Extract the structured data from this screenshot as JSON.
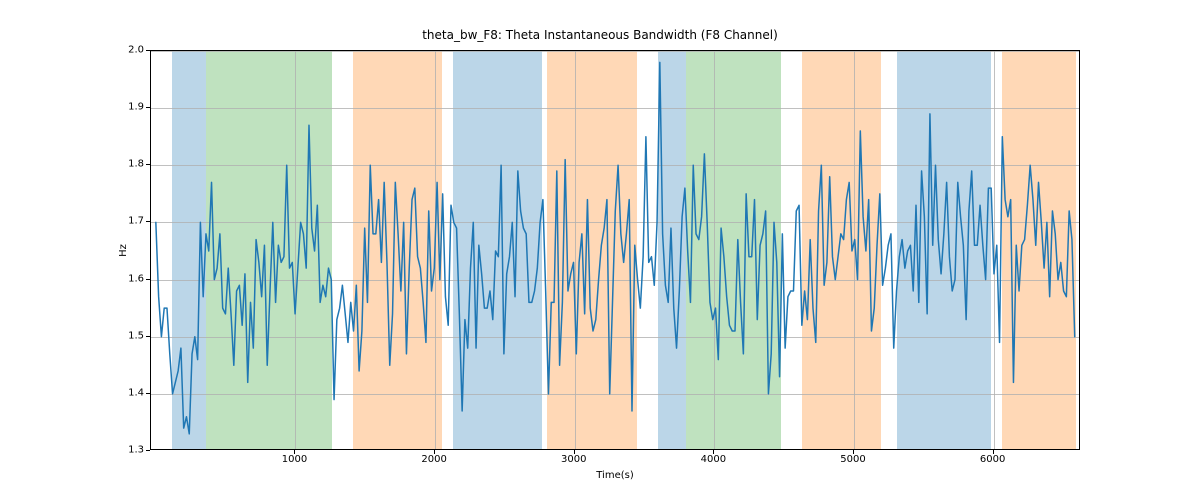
{
  "chart_data": {
    "type": "line",
    "title": "theta_bw_F8: Theta Instantaneous Bandwidth (F8 Channel)",
    "xlabel": "Time(s)",
    "ylabel": "Hz",
    "xlim": [
      -34.7,
      6626.0
    ],
    "ylim": [
      1.3,
      2.0
    ],
    "xticks": [
      1000,
      2000,
      3000,
      4000,
      5000,
      6000
    ],
    "yticks": [
      1.3,
      1.4,
      1.5,
      1.6,
      1.7,
      1.8,
      1.9,
      2.0
    ],
    "ytick_labels": [
      "1.3",
      "1.4",
      "1.5",
      "1.6",
      "1.7",
      "1.8",
      "1.9",
      "2.0"
    ],
    "bands": [
      {
        "start": 113,
        "end": 357,
        "color": "#1f77b4"
      },
      {
        "start": 357,
        "end": 1260,
        "color": "#2ca02c"
      },
      {
        "start": 1411,
        "end": 2050,
        "color": "#ff7f0e"
      },
      {
        "start": 2126,
        "end": 2766,
        "color": "#1f77b4"
      },
      {
        "start": 2804,
        "end": 3443,
        "color": "#ff7f0e"
      },
      {
        "start": 3594,
        "end": 3800,
        "color": "#1f77b4"
      },
      {
        "start": 3800,
        "end": 4478,
        "color": "#2ca02c"
      },
      {
        "start": 4628,
        "end": 5192,
        "color": "#ff7f0e"
      },
      {
        "start": 5305,
        "end": 5983,
        "color": "#1f77b4"
      },
      {
        "start": 6059,
        "end": 6591,
        "color": "#ff7f0e"
      }
    ],
    "series": [
      {
        "name": "theta_bw_F8",
        "color": "#1f77b4",
        "x_start": 0,
        "x_step": 19.9425,
        "values": [
          1.7,
          1.57,
          1.5,
          1.55,
          1.55,
          1.47,
          1.4,
          1.42,
          1.44,
          1.48,
          1.34,
          1.36,
          1.33,
          1.47,
          1.5,
          1.46,
          1.7,
          1.57,
          1.68,
          1.65,
          1.77,
          1.6,
          1.62,
          1.68,
          1.55,
          1.54,
          1.62,
          1.54,
          1.45,
          1.58,
          1.59,
          1.52,
          1.61,
          1.42,
          1.56,
          1.48,
          1.67,
          1.63,
          1.57,
          1.66,
          1.45,
          1.58,
          1.7,
          1.56,
          1.66,
          1.63,
          1.64,
          1.8,
          1.62,
          1.63,
          1.54,
          1.62,
          1.7,
          1.68,
          1.62,
          1.87,
          1.69,
          1.65,
          1.73,
          1.56,
          1.59,
          1.57,
          1.62,
          1.6,
          1.39,
          1.53,
          1.55,
          1.59,
          1.54,
          1.49,
          1.56,
          1.51,
          1.59,
          1.44,
          1.51,
          1.69,
          1.56,
          1.8,
          1.68,
          1.68,
          1.74,
          1.63,
          1.77,
          1.63,
          1.45,
          1.54,
          1.77,
          1.68,
          1.58,
          1.7,
          1.47,
          1.62,
          1.74,
          1.76,
          1.64,
          1.62,
          1.56,
          1.49,
          1.72,
          1.58,
          1.62,
          1.77,
          1.6,
          1.75,
          1.57,
          1.52,
          1.73,
          1.7,
          1.69,
          1.54,
          1.37,
          1.53,
          1.48,
          1.62,
          1.7,
          1.48,
          1.66,
          1.61,
          1.55,
          1.55,
          1.58,
          1.53,
          1.65,
          1.64,
          1.8,
          1.47,
          1.61,
          1.64,
          1.7,
          1.57,
          1.79,
          1.72,
          1.69,
          1.68,
          1.56,
          1.56,
          1.58,
          1.62,
          1.7,
          1.74,
          1.58,
          1.4,
          1.56,
          1.56,
          1.79,
          1.45,
          1.56,
          1.81,
          1.58,
          1.61,
          1.63,
          1.47,
          1.63,
          1.68,
          1.54,
          1.74,
          1.55,
          1.51,
          1.53,
          1.6,
          1.66,
          1.69,
          1.74,
          1.4,
          1.56,
          1.72,
          1.8,
          1.68,
          1.63,
          1.68,
          1.74,
          1.37,
          1.66,
          1.6,
          1.55,
          1.64,
          1.85,
          1.63,
          1.64,
          1.59,
          1.7,
          1.98,
          1.68,
          1.59,
          1.56,
          1.69,
          1.55,
          1.48,
          1.58,
          1.71,
          1.76,
          1.65,
          1.56,
          1.8,
          1.68,
          1.67,
          1.71,
          1.82,
          1.7,
          1.56,
          1.53,
          1.55,
          1.46,
          1.69,
          1.64,
          1.57,
          1.52,
          1.51,
          1.51,
          1.67,
          1.56,
          1.47,
          1.75,
          1.64,
          1.64,
          1.74,
          1.53,
          1.66,
          1.68,
          1.72,
          1.4,
          1.47,
          1.7,
          1.63,
          1.43,
          1.68,
          1.48,
          1.57,
          1.58,
          1.58,
          1.72,
          1.73,
          1.52,
          1.58,
          1.53,
          1.67,
          1.55,
          1.49,
          1.72,
          1.8,
          1.59,
          1.63,
          1.78,
          1.64,
          1.6,
          1.64,
          1.68,
          1.67,
          1.74,
          1.77,
          1.65,
          1.67,
          1.6,
          1.86,
          1.71,
          1.65,
          1.74,
          1.51,
          1.55,
          1.66,
          1.75,
          1.59,
          1.62,
          1.66,
          1.68,
          1.48,
          1.58,
          1.64,
          1.67,
          1.62,
          1.65,
          1.66,
          1.58,
          1.73,
          1.56,
          1.79,
          1.71,
          1.54,
          1.89,
          1.66,
          1.8,
          1.67,
          1.61,
          1.68,
          1.77,
          1.64,
          1.58,
          1.6,
          1.77,
          1.71,
          1.66,
          1.53,
          1.72,
          1.79,
          1.66,
          1.66,
          1.73,
          1.66,
          1.6,
          1.76,
          1.76,
          1.61,
          1.66,
          1.49,
          1.85,
          1.74,
          1.71,
          1.74,
          1.42,
          1.66,
          1.58,
          1.66,
          1.67,
          1.73,
          1.8,
          1.74,
          1.66,
          1.77,
          1.7,
          1.62,
          1.7,
          1.57,
          1.72,
          1.68,
          1.6,
          1.63,
          1.58,
          1.57,
          1.72,
          1.67,
          1.5
        ]
      }
    ]
  }
}
